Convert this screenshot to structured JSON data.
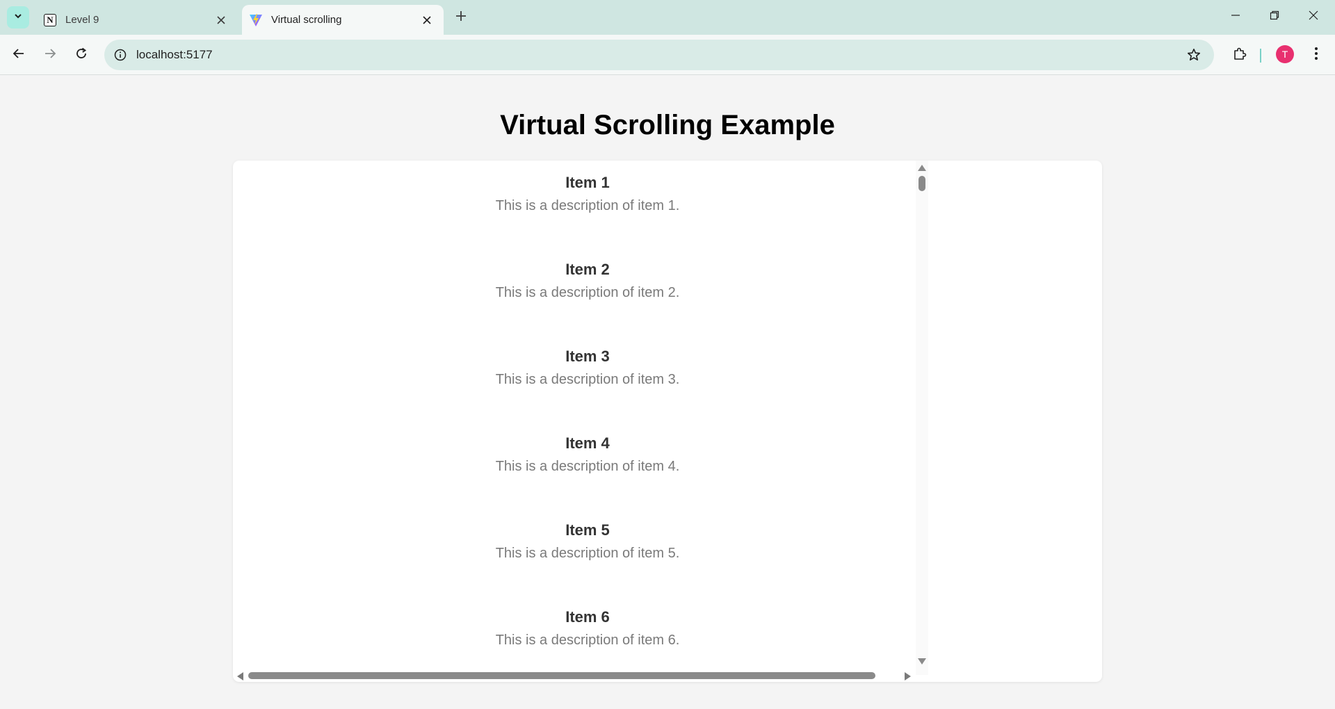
{
  "browser": {
    "tabs": [
      {
        "title": "Level 9",
        "favicon": "notion-icon",
        "favicon_letter": "N",
        "active": false
      },
      {
        "title": "Virtual scrolling",
        "favicon": "vite-icon",
        "active": true
      }
    ],
    "url": "localhost:5177",
    "profile_initial": "T",
    "colors": {
      "tabstrip": "#cfe6e1",
      "omnibox": "#d9ebe7",
      "avatar": "#e8306f"
    }
  },
  "page": {
    "title": "Virtual Scrolling Example",
    "items": [
      {
        "name": "Item 1",
        "description": "This is a description of item 1."
      },
      {
        "name": "Item 2",
        "description": "This is a description of item 2."
      },
      {
        "name": "Item 3",
        "description": "This is a description of item 3."
      },
      {
        "name": "Item 4",
        "description": "This is a description of item 4."
      },
      {
        "name": "Item 5",
        "description": "This is a description of item 5."
      },
      {
        "name": "Item 6",
        "description": "This is a description of item 6."
      }
    ]
  }
}
